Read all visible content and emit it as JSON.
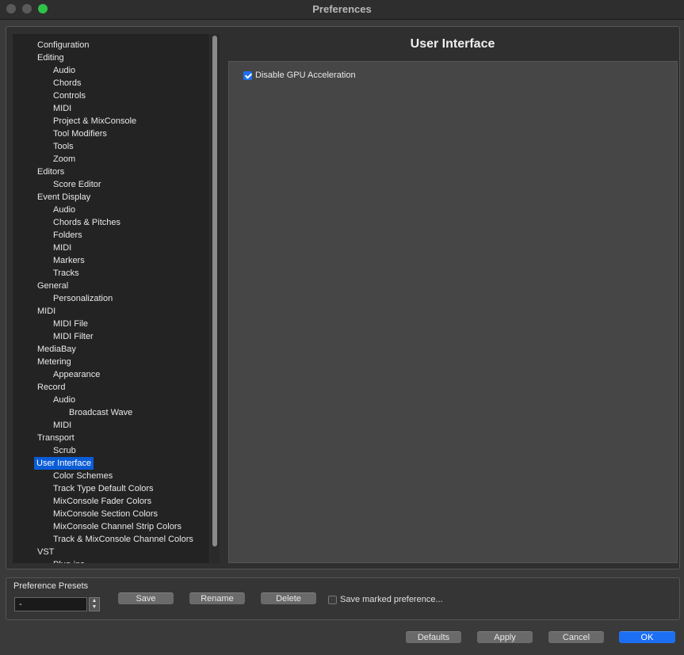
{
  "window": {
    "title": "Preferences"
  },
  "tree": {
    "items": [
      {
        "label": "Configuration",
        "level": 0
      },
      {
        "label": "Editing",
        "level": 0
      },
      {
        "label": "Audio",
        "level": 1
      },
      {
        "label": "Chords",
        "level": 1
      },
      {
        "label": "Controls",
        "level": 1
      },
      {
        "label": "MIDI",
        "level": 1
      },
      {
        "label": "Project & MixConsole",
        "level": 1
      },
      {
        "label": "Tool Modifiers",
        "level": 1
      },
      {
        "label": "Tools",
        "level": 1
      },
      {
        "label": "Zoom",
        "level": 1
      },
      {
        "label": "Editors",
        "level": 0
      },
      {
        "label": "Score Editor",
        "level": 1
      },
      {
        "label": "Event Display",
        "level": 0
      },
      {
        "label": "Audio",
        "level": 1
      },
      {
        "label": "Chords & Pitches",
        "level": 1
      },
      {
        "label": "Folders",
        "level": 1
      },
      {
        "label": "MIDI",
        "level": 1
      },
      {
        "label": "Markers",
        "level": 1
      },
      {
        "label": "Tracks",
        "level": 1
      },
      {
        "label": "General",
        "level": 0
      },
      {
        "label": "Personalization",
        "level": 1
      },
      {
        "label": "MIDI",
        "level": 0
      },
      {
        "label": "MIDI File",
        "level": 1
      },
      {
        "label": "MIDI Filter",
        "level": 1
      },
      {
        "label": "MediaBay",
        "level": 0
      },
      {
        "label": "Metering",
        "level": 0
      },
      {
        "label": "Appearance",
        "level": 1
      },
      {
        "label": "Record",
        "level": 0
      },
      {
        "label": "Audio",
        "level": 1
      },
      {
        "label": "Broadcast Wave",
        "level": 2
      },
      {
        "label": "MIDI",
        "level": 1
      },
      {
        "label": "Transport",
        "level": 0
      },
      {
        "label": "Scrub",
        "level": 1
      },
      {
        "label": "User Interface",
        "level": 0,
        "selected": true
      },
      {
        "label": "Color Schemes",
        "level": 1
      },
      {
        "label": "Track Type Default Colors",
        "level": 1
      },
      {
        "label": "MixConsole Fader Colors",
        "level": 1
      },
      {
        "label": "MixConsole Section Colors",
        "level": 1
      },
      {
        "label": "MixConsole Channel Strip Colors",
        "level": 1
      },
      {
        "label": "Track & MixConsole Channel Colors",
        "level": 1
      },
      {
        "label": "VST",
        "level": 0
      },
      {
        "label": "Plug-ins",
        "level": 1
      }
    ]
  },
  "page": {
    "heading": "User Interface",
    "gpu_option": {
      "label": "Disable GPU Acceleration",
      "checked": true
    }
  },
  "presets": {
    "label": "Preference Presets",
    "selected": "-",
    "save_label": "Save",
    "rename_label": "Rename",
    "delete_label": "Delete",
    "save_marked_label": "Save marked preference...",
    "save_marked_checked": false
  },
  "footer": {
    "defaults_label": "Defaults",
    "apply_label": "Apply",
    "cancel_label": "Cancel",
    "ok_label": "OK"
  },
  "colors": {
    "accent": "#0a5cd7",
    "ok_button": "#1d6ff2"
  }
}
